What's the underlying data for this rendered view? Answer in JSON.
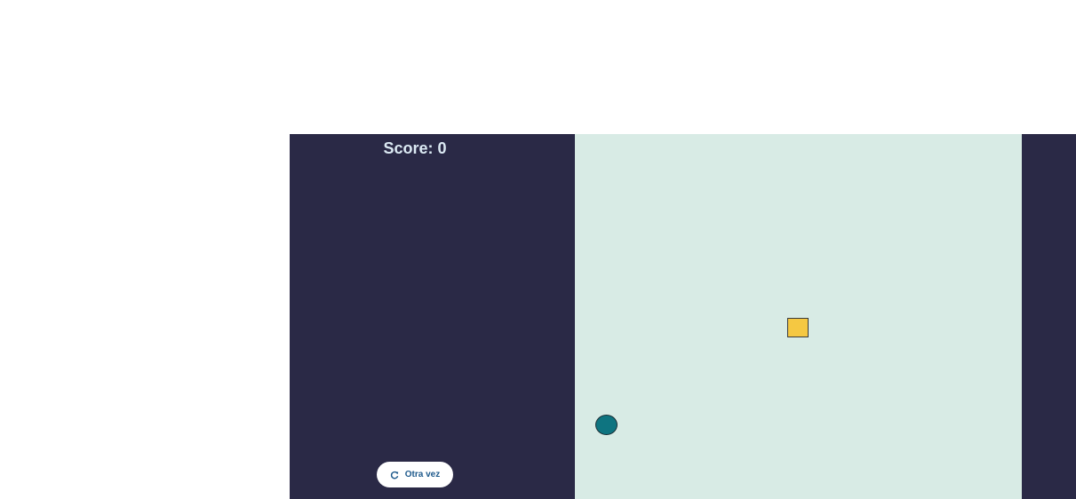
{
  "hud": {
    "score_label": "Score:",
    "score_value": "0"
  },
  "controls": {
    "replay_label": "Otra vez",
    "replay_icon": "refresh-icon"
  },
  "colors": {
    "panel_background": "#2a2946",
    "board_background": "#d8ebe5",
    "food": "#f5c842",
    "player": "#0e7480",
    "score_text": "#dbe9f3",
    "button_text": "#1e5a8c"
  }
}
